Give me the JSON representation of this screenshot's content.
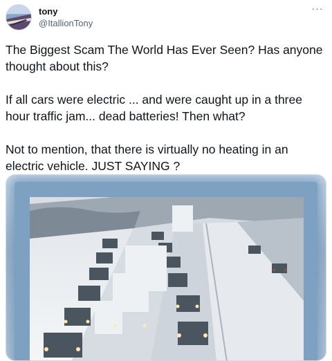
{
  "author": {
    "name": "tony",
    "handle": "@ItallionTony"
  },
  "menu": {
    "more_glyph": "···"
  },
  "tweet": {
    "paragraphs": [
      "The Biggest Scam The World Has Ever Seen? Has anyone thought about this?",
      "If all cars were electric ... and were caught up in a three hour traffic jam...  dead batteries! Then what?",
      "Not to mention, that there is virtually no heating in an electric vehicle.   JUST  SAYING  ?"
    ]
  },
  "colors": {
    "text": "#0f1419",
    "secondary": "#536471",
    "frame_glow": "#7fa1c1"
  },
  "icons": {
    "avatar": "avatar-image",
    "more": "more-options-icon"
  }
}
